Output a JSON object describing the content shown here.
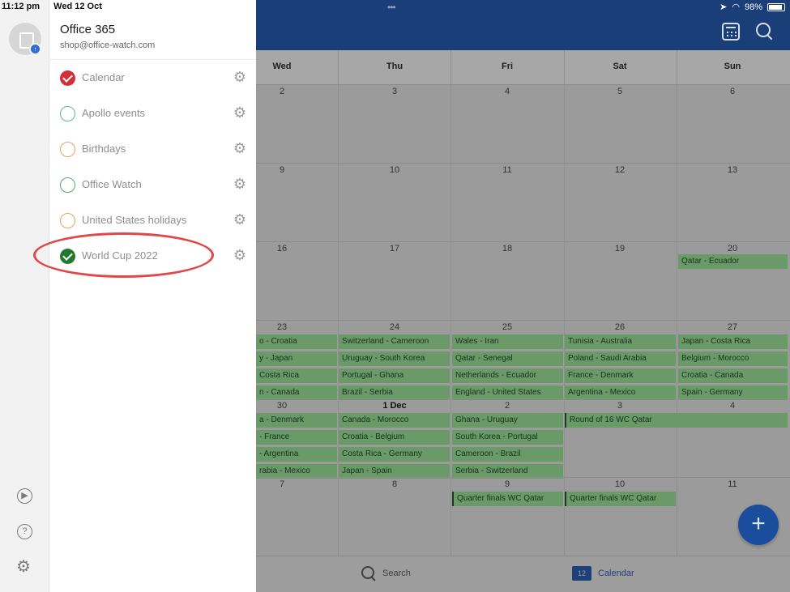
{
  "status": {
    "time": "11:12 pm",
    "date": "Wed 12 Oct",
    "battery": "98%"
  },
  "drawer": {
    "account_title": "Office 365",
    "account_email": "shop@office-watch.com",
    "calendars": [
      {
        "label": "Calendar",
        "color": "#d32f3a",
        "checked": true
      },
      {
        "label": "Apollo events",
        "color": "#5fb39a",
        "checked": false
      },
      {
        "label": "Birthdays",
        "color": "#e9a25c",
        "checked": false
      },
      {
        "label": "Office Watch",
        "color": "#4ea86b",
        "checked": false
      },
      {
        "label": "United States holidays",
        "color": "#e9a25c",
        "checked": false
      },
      {
        "label": "World Cup 2022",
        "color": "#1f7a2e",
        "checked": true
      }
    ]
  },
  "calendar": {
    "day_headers": [
      "Wed",
      "Thu",
      "Fri",
      "Sat",
      "Sun"
    ],
    "weeks": [
      [
        "2",
        "3",
        "4",
        "5",
        "6"
      ],
      [
        "9",
        "10",
        "11",
        "12",
        "13"
      ],
      [
        "16",
        "17",
        "18",
        "19",
        "20"
      ],
      [
        "23",
        "24",
        "25",
        "26",
        "27"
      ],
      [
        "30",
        "1 Dec",
        "2",
        "3",
        "4"
      ],
      [
        "7",
        "8",
        "9",
        "10",
        "11"
      ]
    ],
    "events": {
      "w3_sun": "Qatar - Ecuador",
      "w4": [
        [
          "o - Croatia",
          "Switzerland - Cameroon",
          "Wales - Iran",
          "Tunisia - Australia",
          "Japan - Costa Rica"
        ],
        [
          "y - Japan",
          "Uruguay - South Korea",
          "Qatar - Senegal",
          "Poland - Saudi Arabia",
          "Belgium - Morocco"
        ],
        [
          "Costa Rica",
          "Portugal - Ghana",
          "Netherlands - Ecuador",
          "France - Denmark",
          "Croatia - Canada"
        ],
        [
          "n - Canada",
          "Brazil - Serbia",
          "England - United States",
          "Argentina - Mexico",
          "Spain - Germany"
        ]
      ],
      "w5": [
        [
          "a - Denmark",
          "Canada - Morocco",
          "Ghana - Uruguay"
        ],
        [
          "- France",
          "Croatia - Belgium",
          "South Korea - Portugal"
        ],
        [
          "- Argentina",
          "Costa Rica - Germany",
          "Cameroon - Brazil"
        ],
        [
          "rabia - Mexico",
          "Japan - Spain",
          "Serbia - Switzerland"
        ]
      ],
      "w5_round16": "Round of 16 WC Qatar",
      "w6_qf1": "Quarter finals WC Qatar",
      "w6_qf2": "Quarter finals WC Qatar"
    }
  },
  "bottom": {
    "search_label": "Search",
    "calendar_label": "Calendar",
    "calendar_icon_day": "12"
  },
  "fab_label": "+"
}
